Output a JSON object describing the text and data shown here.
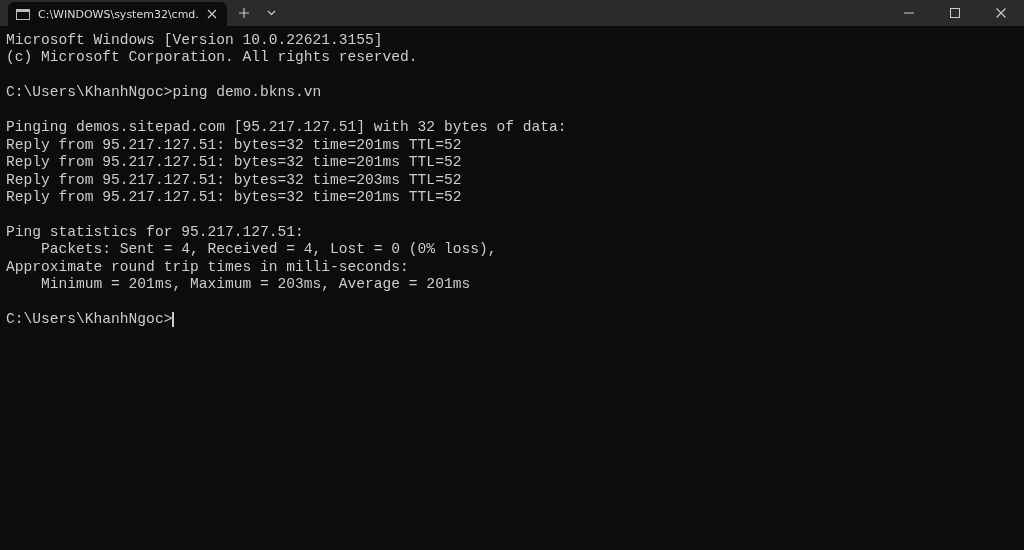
{
  "tab": {
    "title": "C:\\WINDOWS\\system32\\cmd.",
    "selected": true
  },
  "console": {
    "blocks": [
      [
        "Microsoft Windows [Version 10.0.22621.3155]",
        "(c) Microsoft Corporation. All rights reserved."
      ],
      [
        "C:\\Users\\KhanhNgoc>ping demo.bkns.vn"
      ],
      [
        "Pinging demos.sitepad.com [95.217.127.51] with 32 bytes of data:",
        "Reply from 95.217.127.51: bytes=32 time=201ms TTL=52",
        "Reply from 95.217.127.51: bytes=32 time=201ms TTL=52",
        "Reply from 95.217.127.51: bytes=32 time=203ms TTL=52",
        "Reply from 95.217.127.51: bytes=32 time=201ms TTL=52"
      ],
      [
        "Ping statistics for 95.217.127.51:",
        "    Packets: Sent = 4, Received = 4, Lost = 0 (0% loss),",
        "Approximate round trip times in milli-seconds:",
        "    Minimum = 201ms, Maximum = 203ms, Average = 201ms"
      ]
    ],
    "prompt": "C:\\Users\\KhanhNgoc>"
  }
}
